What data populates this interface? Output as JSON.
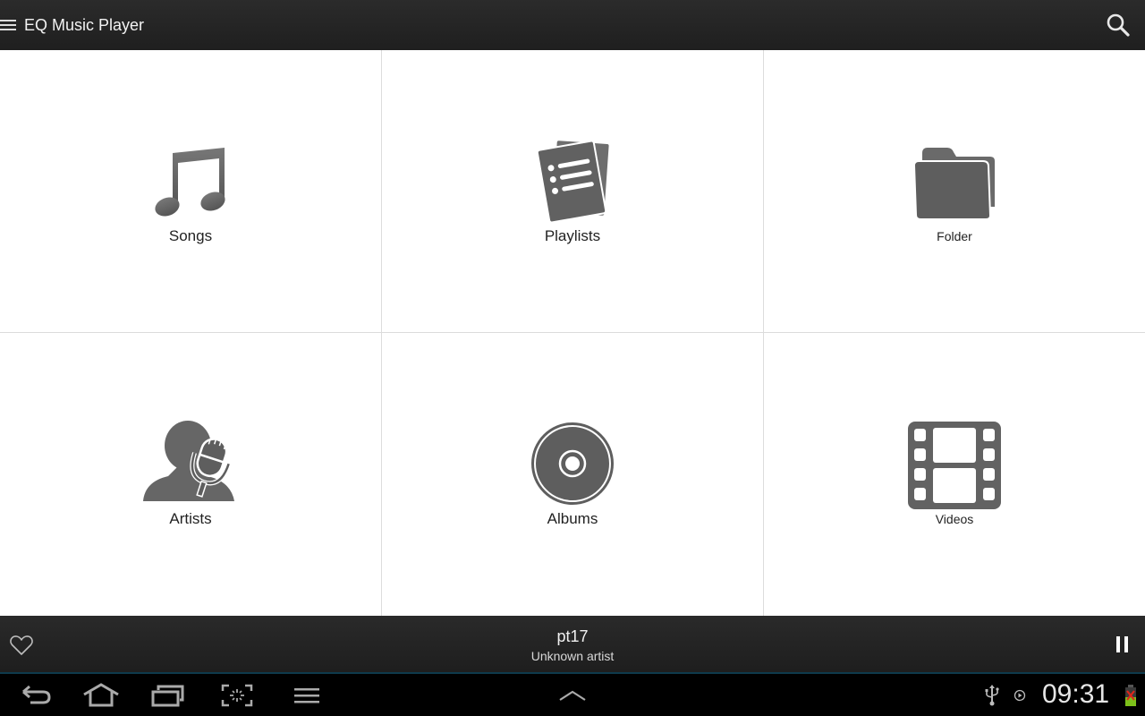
{
  "actionbar": {
    "title": "EQ Music Player",
    "menu_icon": "hamburger-icon",
    "search_icon": "search-icon"
  },
  "categories": [
    {
      "label": "Songs",
      "icon": "music-note-icon"
    },
    {
      "label": "Playlists",
      "icon": "playlist-icon"
    },
    {
      "label": "Folder",
      "icon": "folder-icon"
    },
    {
      "label": "Artists",
      "icon": "artist-microphone-icon"
    },
    {
      "label": "Albums",
      "icon": "album-disc-icon"
    },
    {
      "label": "Videos",
      "icon": "film-strip-icon"
    }
  ],
  "now_playing": {
    "title": "pt17",
    "artist": "Unknown artist",
    "favorite_icon": "heart-outline-icon",
    "control_icon": "pause-icon"
  },
  "system_bar": {
    "buttons": [
      "back-icon",
      "home-icon",
      "recent-apps-icon",
      "screenshot-icon",
      "menu-icon"
    ],
    "center_icon": "chevron-up-icon",
    "status_icons": [
      "usb-icon",
      "media-play-icon",
      "battery-icon"
    ],
    "time": "09:31"
  },
  "colors": {
    "actionbar_bg": "#232323",
    "icon_gray": "#666666",
    "divider": "#dcdcdc",
    "accent_line": "#0e3a4c",
    "battery_green": "#7cc11a",
    "battery_alert": "#e0261b"
  }
}
